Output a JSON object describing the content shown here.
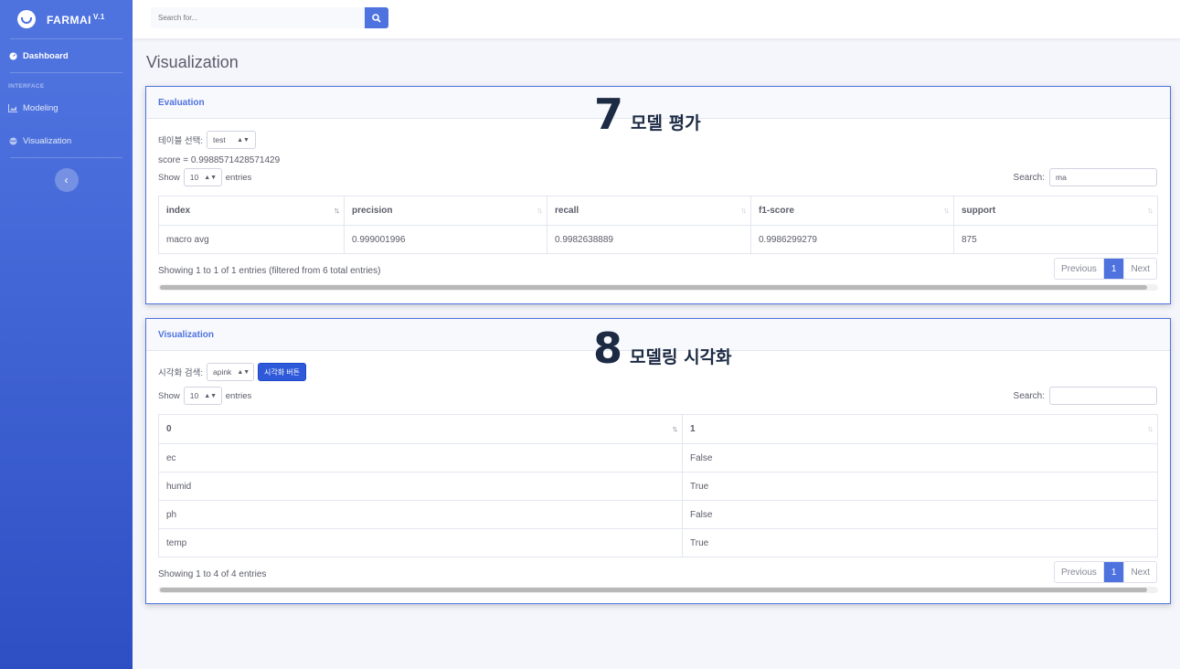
{
  "sidebar": {
    "brand": "FARMAI",
    "brand_version": "V.1",
    "dashboard_label": "Dashboard",
    "section_heading": "INTERFACE",
    "items": [
      {
        "label": "Modeling",
        "icon": "chart-area-icon"
      },
      {
        "label": "Visualization",
        "icon": "globe-icon"
      }
    ],
    "toggle_icon": "chevron-left-icon"
  },
  "topbar": {
    "search_placeholder": "Search for...",
    "search_icon": "search-icon"
  },
  "page_title": "Visualization",
  "evaluation": {
    "title": "Evaluation",
    "overlay_number": "7",
    "overlay_text": "모델 평가",
    "table_select_label": "테이블 선택:",
    "table_select_value": "test",
    "score_text": "score = 0.9988571428571429",
    "show_label": "Show",
    "entries_value": "10",
    "entries_label": "entries",
    "search_label": "Search:",
    "search_value": "ma",
    "columns": [
      "index",
      "precision",
      "recall",
      "f1-score",
      "support"
    ],
    "rows": [
      [
        "macro avg",
        "0.999001996",
        "0.9982638889",
        "0.9986299279",
        "875"
      ]
    ],
    "info": "Showing 1 to 1 of 1 entries (filtered from 6 total entries)",
    "pager": {
      "prev": "Previous",
      "current": "1",
      "next": "Next"
    }
  },
  "visualization": {
    "title": "Visualization",
    "overlay_number": "8",
    "overlay_text": "모델링 시각화",
    "search_label": "시각화 검색:",
    "select_value": "apink",
    "button_label": "시각화 버튼",
    "show_label": "Show",
    "entries_value": "10",
    "entries_label": "entries",
    "filter_label": "Search:",
    "filter_value": "",
    "columns": [
      "0",
      "1"
    ],
    "rows": [
      [
        "ec",
        "False"
      ],
      [
        "humid",
        "True"
      ],
      [
        "ph",
        "False"
      ],
      [
        "temp",
        "True"
      ]
    ],
    "info": "Showing 1 to 4 of 4 entries",
    "pager": {
      "prev": "Previous",
      "current": "1",
      "next": "Next"
    }
  },
  "colors": {
    "primary": "#4e73df",
    "sidebar_bottom": "#2e4fc4",
    "text": "#5a5c69"
  }
}
